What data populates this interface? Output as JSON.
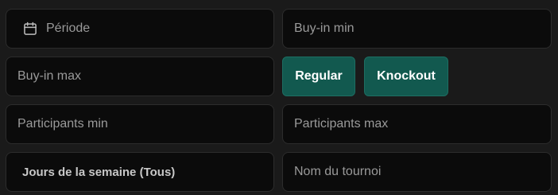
{
  "filters": {
    "period": {
      "placeholder": "Période",
      "icon": "calendar-icon"
    },
    "buyin_min": {
      "placeholder": "Buy-in min"
    },
    "buyin_max": {
      "placeholder": "Buy-in max"
    },
    "type_buttons": [
      {
        "label": "Regular"
      },
      {
        "label": "Knockout"
      }
    ],
    "participants_min": {
      "placeholder": "Participants min"
    },
    "participants_max": {
      "placeholder": "Participants max"
    },
    "weekdays": {
      "label": "Jours de la semaine (Tous)"
    },
    "tournament_name": {
      "placeholder": "Nom du tournoi"
    }
  },
  "colors": {
    "background": "#1a1a1a",
    "field_bg": "#0b0b0b",
    "field_border": "#2c2c2c",
    "button_bg": "#12594f",
    "placeholder_text": "#9a9a9a"
  }
}
